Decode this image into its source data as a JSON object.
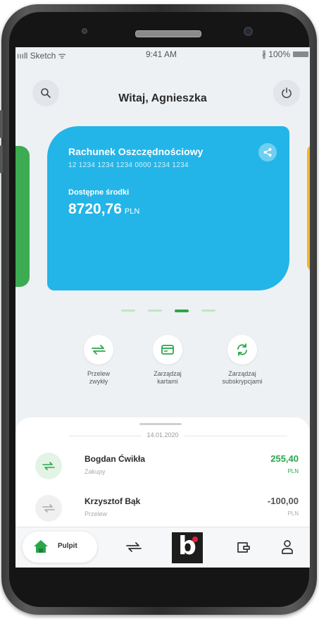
{
  "status_bar": {
    "carrier": "ıııll Sketch ᯤ",
    "time": "9:41 AM",
    "battery": "∦ 100%"
  },
  "header": {
    "greeting": "Witaj, Agnieszka"
  },
  "card": {
    "name": "Rachunek Oszczędnościowy",
    "number": "12 1234 1234 1234 0000 1234 1234",
    "balance_label": "Dostępne środki",
    "balance": "8720,76",
    "currency": "PLN"
  },
  "carousel": {
    "count": 4,
    "active_index": 2
  },
  "actions": [
    {
      "label": "Przelew\nzwykły",
      "icon": "transfer-icon"
    },
    {
      "label": "Zarządzaj\nkartami",
      "icon": "card-icon"
    },
    {
      "label": "Zarządzaj\nsubskrypcjami",
      "icon": "refresh-icon"
    }
  ],
  "history": {
    "date": "14.01.2020",
    "transactions": [
      {
        "name": "Bogdan Ćwikła",
        "category": "Zakupy",
        "amount": "255,40",
        "currency": "PLN",
        "color": "#2aa64a"
      },
      {
        "name": "Krzysztof Bąk",
        "category": "Przelew",
        "amount": "-100,00",
        "currency": "PLN",
        "color": "#555555"
      }
    ]
  },
  "bottom_nav": {
    "home_label": "Pulpit"
  },
  "colors": {
    "accent_green": "#2aa64a",
    "card_blue": "#23b5e8",
    "brand_red": "#e3213a"
  }
}
